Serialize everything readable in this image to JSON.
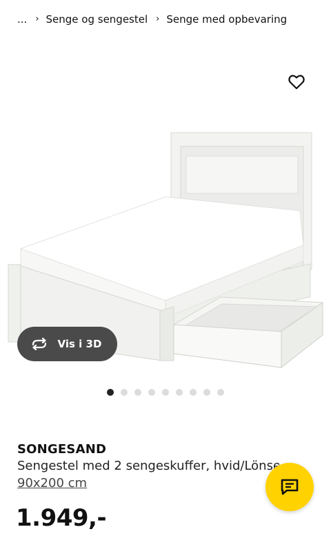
{
  "breadcrumb": {
    "ellipsis": "...",
    "items": [
      "Senge og sengestel",
      "Senge med opbevaring"
    ]
  },
  "icons": {
    "breadcrumb_separator": "chevron-right-icon",
    "favorite": "heart-outline-icon",
    "view3d": "rotate-arrows-icon",
    "chat": "chat-bubble-icon"
  },
  "view3d": {
    "label": "Vis i 3D"
  },
  "carousel": {
    "count": 9,
    "active_index": 0
  },
  "product": {
    "name": "SONGESAND",
    "description": "Sengestel med 2 sengeskuffer, hvid/Lönset",
    "size": "90x200 cm",
    "price": "1.949,-"
  },
  "colors": {
    "chat_button": "#ffd200",
    "view3d_button": "#4a4a4a",
    "dot_active": "#222222",
    "dot_inactive": "#dcdcdc"
  }
}
